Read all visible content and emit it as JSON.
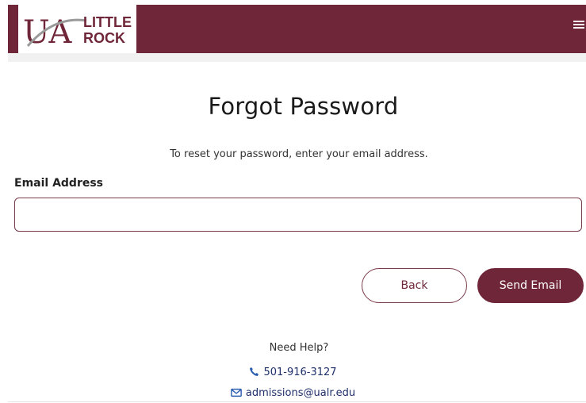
{
  "header": {
    "logo": {
      "monogram": "UA",
      "line1": "LITTLE",
      "line2": "ROCK"
    },
    "menu_icon": "hamburger-menu-icon"
  },
  "main": {
    "title": "Forgot Password",
    "subtitle": "To reset your password, enter your email address.",
    "email_label": "Email Address",
    "email_value": "",
    "back_label": "Back",
    "send_label": "Send Email"
  },
  "help": {
    "heading": "Need Help?",
    "phone": "501-916-3127",
    "email": "admissions@ualr.edu"
  },
  "colors": {
    "brand": "#6f2639",
    "link": "#1f2f6a",
    "icon": "#2a5db0"
  }
}
